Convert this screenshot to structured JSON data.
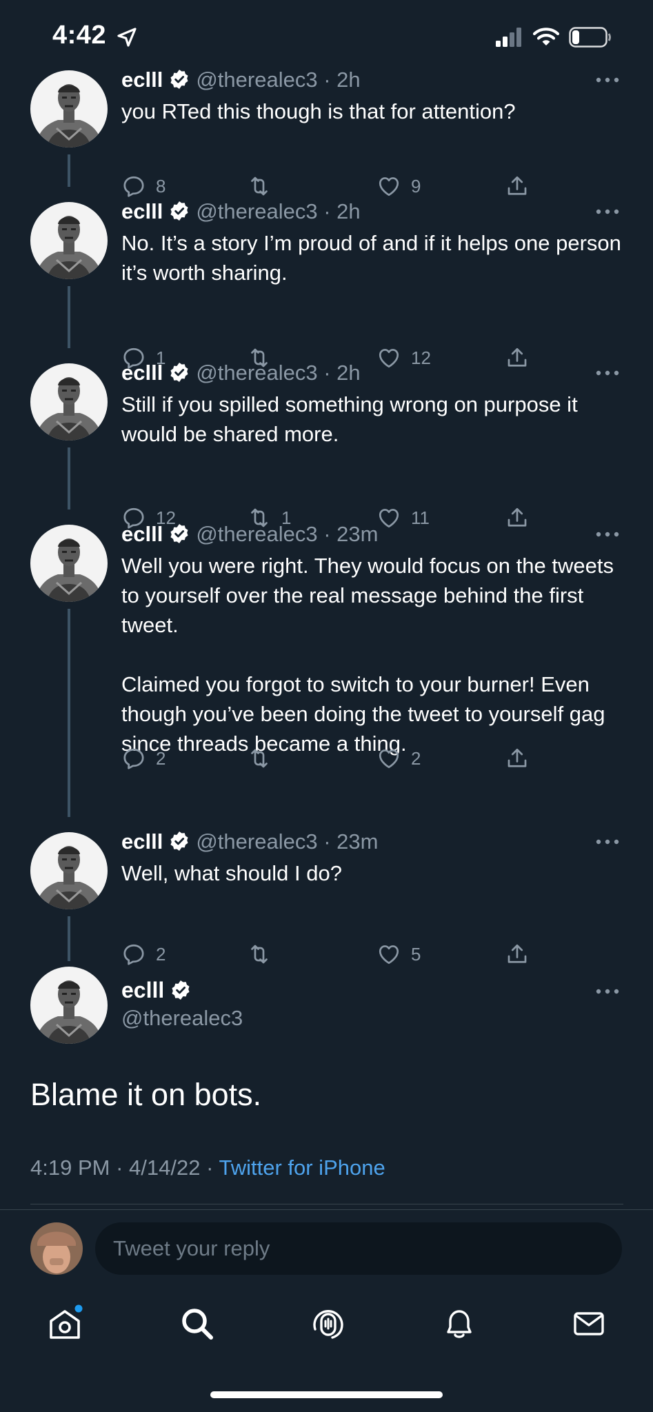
{
  "status_bar": {
    "time": "4:42",
    "battery_level": 0.2
  },
  "tweets": [
    {
      "name": "eclll",
      "handle": "@therealec3",
      "time": "2h",
      "text": "you RTed this though is that for attention?",
      "replies": "8",
      "retweets": "",
      "likes": "9"
    },
    {
      "name": "eclll",
      "handle": "@therealec3",
      "time": "2h",
      "text": "No. It’s a story I’m proud of and if it helps one person it’s worth sharing.",
      "replies": "1",
      "retweets": "",
      "likes": "12"
    },
    {
      "name": "eclll",
      "handle": "@therealec3",
      "time": "2h",
      "text": "Still if you spilled something wrong on purpose it would be shared more.",
      "replies": "12",
      "retweets": "1",
      "likes": "11"
    },
    {
      "name": "eclll",
      "handle": "@therealec3",
      "time": "23m",
      "text": "Well you were right. They would focus on the tweets to yourself over the real message behind the first tweet.\n\nClaimed you forgot to switch to your burner! Even though you’ve been doing the tweet to yourself gag since threads became a thing.",
      "replies": "2",
      "retweets": "",
      "likes": "2"
    },
    {
      "name": "eclll",
      "handle": "@therealec3",
      "time": "23m",
      "text": "Well, what should I do?",
      "replies": "2",
      "retweets": "",
      "likes": "5"
    }
  ],
  "separator": "·",
  "main_tweet": {
    "name": "eclll",
    "handle": "@therealec3",
    "text": "Blame it on bots.",
    "time": "4:19 PM",
    "date": "4/14/22",
    "source": "Twitter for iPhone"
  },
  "reply_bar": {
    "placeholder": "Tweet your reply"
  },
  "tab_bar": {
    "items": [
      "home-icon",
      "search-icon",
      "spaces-icon",
      "notifications-icon",
      "messages-icon"
    ]
  },
  "colors": {
    "background": "#15202b",
    "accent": "#1d9bf0",
    "link": "#4ea3ed",
    "muted": "#8b98a5",
    "thread_line": "#3d5466"
  }
}
